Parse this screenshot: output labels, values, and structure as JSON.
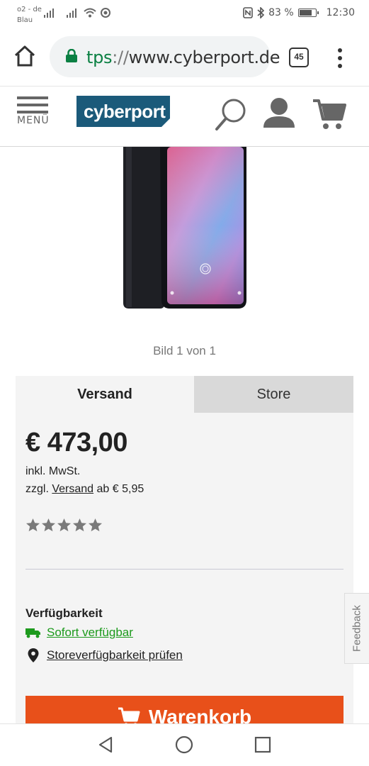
{
  "status_bar": {
    "carrier_line1": "o2 - de",
    "carrier_line2": "Blau",
    "battery_percent": "83 %",
    "battery_level": 0.83,
    "time": "12:30"
  },
  "browser": {
    "url_scheme": "tps",
    "url_separator": "://",
    "url_host": "www.cyberport.de",
    "tab_count": "45"
  },
  "site_header": {
    "menu_label": "MENÜ",
    "logo_text": "cyberport"
  },
  "gallery": {
    "caption": "Bild 1 von 1"
  },
  "purchase_panel": {
    "tabs": [
      {
        "label": "Versand",
        "active": true
      },
      {
        "label": "Store",
        "active": false
      }
    ],
    "price": "€ 473,00",
    "vat_note": "inkl. MwSt.",
    "shipping_prefix": "zzgl.",
    "shipping_link": "Versand",
    "shipping_suffix": "ab € 5,95",
    "rating": {
      "filled_stars": 0,
      "max_stars": 5
    },
    "availability_title": "Verfügbarkeit",
    "availability_status": "Sofort verfügbar",
    "store_check_link": "Storeverfügbarkeit prüfen",
    "cart_button_label": "Warenkorb"
  },
  "feedback_tab": {
    "label": "Feedback"
  },
  "colors": {
    "brand_blue": "#1b5a7a",
    "cta_orange": "#e8501a",
    "available_green": "#1d9a1d",
    "secure_green": "#0b8043"
  }
}
